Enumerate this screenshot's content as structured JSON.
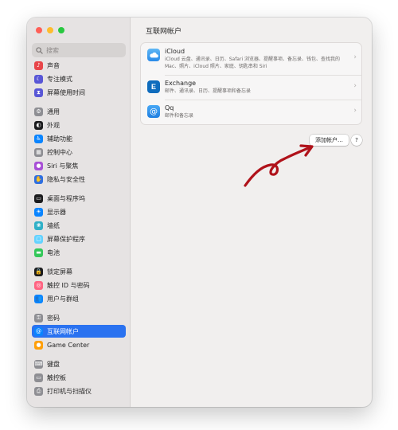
{
  "search": {
    "placeholder": "搜索"
  },
  "sidebar": {
    "items": [
      {
        "label": "声音",
        "icon": "speaker-icon",
        "color": "#e8464a",
        "glyph": "♪"
      },
      {
        "label": "专注模式",
        "icon": "moon-icon",
        "color": "#5856d6",
        "glyph": "☾"
      },
      {
        "label": "屏幕使用时间",
        "icon": "hourglass-icon",
        "color": "#5856d6",
        "glyph": "⧗"
      },
      {
        "label": "通用",
        "icon": "gear-icon",
        "color": "#8e8e93",
        "glyph": "⚙"
      },
      {
        "label": "外观",
        "icon": "appearance-icon",
        "color": "#1c1c1e",
        "glyph": "◐"
      },
      {
        "label": "辅助功能",
        "icon": "accessibility-icon",
        "color": "#0a84ff",
        "glyph": "♿"
      },
      {
        "label": "控制中心",
        "icon": "control-center-icon",
        "color": "#8e8e93",
        "glyph": "▦"
      },
      {
        "label": "Siri 与聚焦",
        "icon": "siri-icon",
        "color": "#a84fd6",
        "glyph": "●"
      },
      {
        "label": "隐私与安全性",
        "icon": "hand-icon",
        "color": "#2f6fe0",
        "glyph": "✋"
      },
      {
        "label": "桌面与程序坞",
        "icon": "dock-icon",
        "color": "#1c1c1e",
        "glyph": "▭"
      },
      {
        "label": "显示器",
        "icon": "display-icon",
        "color": "#0a84ff",
        "glyph": "☀"
      },
      {
        "label": "墙纸",
        "icon": "wallpaper-icon",
        "color": "#30b0c7",
        "glyph": "❀"
      },
      {
        "label": "屏幕保护程序",
        "icon": "screensaver-icon",
        "color": "#64d2ff",
        "glyph": "▢"
      },
      {
        "label": "电池",
        "icon": "battery-icon",
        "color": "#34c759",
        "glyph": "▬"
      },
      {
        "label": "锁定屏幕",
        "icon": "lock-icon",
        "color": "#1c1c1e",
        "glyph": "🔒"
      },
      {
        "label": "触控 ID 与密码",
        "icon": "fingerprint-icon",
        "color": "#ff6482",
        "glyph": "◎"
      },
      {
        "label": "用户与群组",
        "icon": "users-icon",
        "color": "#0a84ff",
        "glyph": "👥"
      },
      {
        "label": "密码",
        "icon": "key-icon",
        "color": "#8e8e93",
        "glyph": "⚿"
      },
      {
        "label": "互联网帐户",
        "icon": "at-icon",
        "color": "#0a84ff",
        "glyph": "@",
        "selected": true
      },
      {
        "label": "Game Center",
        "icon": "game-center-icon",
        "color": "#ff9f0a",
        "glyph": "●"
      },
      {
        "label": "键盘",
        "icon": "keyboard-icon",
        "color": "#8e8e93",
        "glyph": "⌨"
      },
      {
        "label": "触控板",
        "icon": "trackpad-icon",
        "color": "#8e8e93",
        "glyph": "▭"
      },
      {
        "label": "打印机与扫描仪",
        "icon": "printer-icon",
        "color": "#8e8e93",
        "glyph": "⎙"
      }
    ]
  },
  "main": {
    "title": "互联网帐户",
    "accounts": [
      {
        "name": "iCloud",
        "desc": "iCloud 云盘、通讯录、日历、Safari 浏览器、提醒事项、备忘录、钱包、查找我的 Mac、照片、iCloud 照片、家庭、钥匙串和 Siri"
      },
      {
        "name": "Exchange",
        "desc": "邮件、通讯录、日历、提醒事项和备忘录"
      },
      {
        "name": "Qq",
        "desc": "邮件和备忘录"
      }
    ],
    "add_account_label": "添加帐户…",
    "help_label": "?"
  },
  "colors": {
    "accent": "#2a72f0",
    "annotation_arrow": "#b0121a"
  }
}
